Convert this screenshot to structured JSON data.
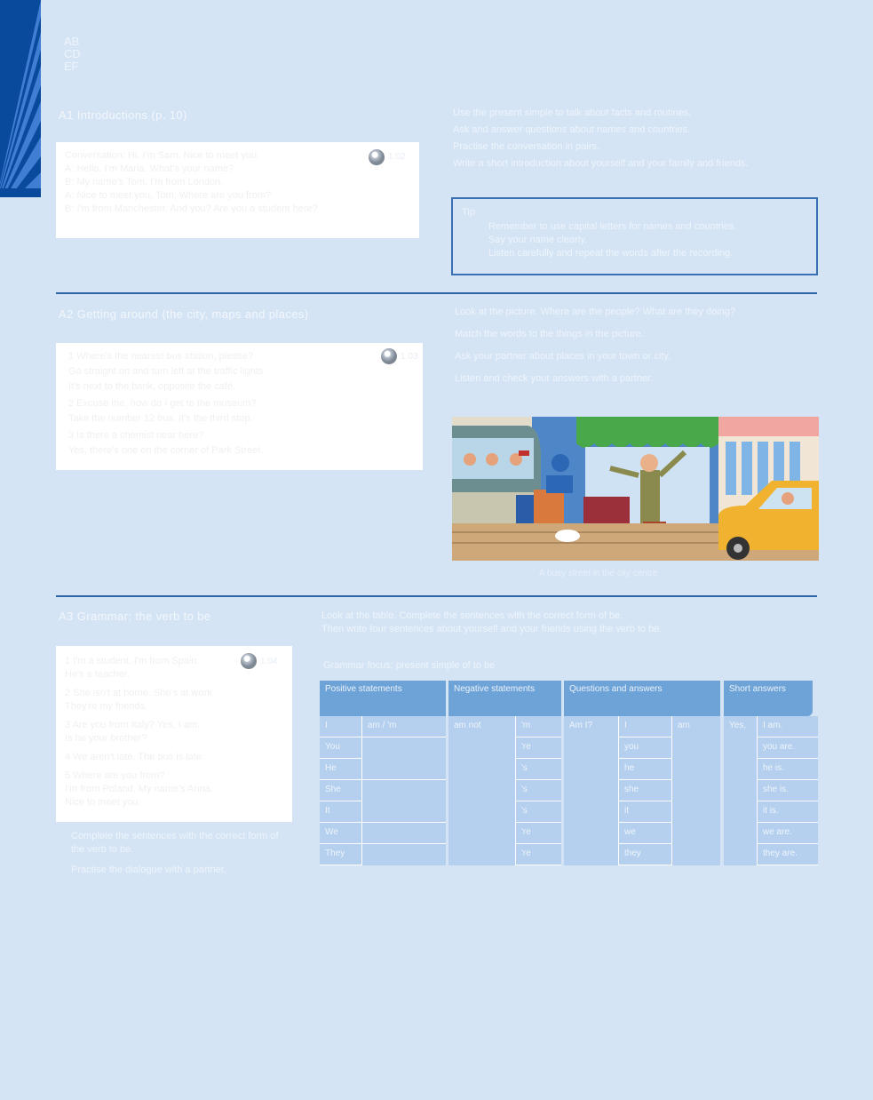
{
  "page": {
    "corner_code": [
      "AB",
      "CD",
      "EF"
    ],
    "colors": {
      "background": "#d4e4f5",
      "rule": "#2f64a8",
      "tab_dark": "#0a4a9c",
      "table_header": "#6ea3d8",
      "table_body": "#b4d0ee"
    }
  },
  "section1": {
    "heading": "A1  Introductions  (p. 10)",
    "box_lines": [
      "Conversation: Hi, I'm Sam. Nice to meet you.",
      "A: Hello. I'm Maria. What's your name?",
      "B: My name's Tom. I'm from London.",
      "A: Nice to meet you, Tom. Where are you from?",
      "B: I'm from Manchester. And you? Are you a student here?"
    ],
    "cd_label": "1.02",
    "right_bullets": [
      "Use the present simple to talk about facts and routines.",
      "Ask and answer questions about names and countries.",
      "Practise the conversation in pairs.",
      "Write a short introduction about yourself and your family and friends."
    ],
    "note_title": "Tip",
    "note_lines": [
      "Remember to use capital letters for names and countries.",
      "Say your name clearly.",
      "Listen carefully and repeat the words after the recording."
    ]
  },
  "section2": {
    "heading": "A2  Getting around  (the city, maps and places)",
    "box_items": [
      "1  Where's the nearest bus station, please?",
      "   Go straight on and turn left at the traffic lights.",
      "   It's next to the bank, opposite the café.",
      "2  Excuse me, how do I get to the museum?",
      "   Take the number 12 bus. It's the third stop.",
      "3  Is there a chemist near here?",
      "   Yes, there's one on the corner of Park Street."
    ],
    "cd_label": "1.03",
    "right_bullets": [
      "Look at the picture. Where are the people? What are they doing?",
      "Match the words to the things in the picture.",
      "Ask your partner about places in your town or city.",
      "Listen and check your answers with a partner."
    ],
    "caption": "A busy street in the city centre"
  },
  "section3": {
    "heading": "A3  Grammar: the verb to be",
    "box_items": [
      "1  I'm a student. I'm from Spain.",
      "   He's a teacher.",
      "2  She isn't at home. She's at work.",
      "   They're my friends.",
      "3  Are you from Italy? Yes, I am.",
      "   Is he your brother?",
      "4  We aren't late. The bus is late.",
      "5  Where are you from?",
      "   I'm from Poland. My name's Anna.",
      "   Nice to meet you."
    ],
    "cd_label": "1.04",
    "below_bullets": [
      "Complete the sentences with the correct form of the verb to be.",
      "Practise the dialogue with a partner."
    ],
    "intro_lines": [
      "Look at the table. Complete the sentences with the correct form of be.",
      "Then write four sentences about yourself and your friends using the verb to be."
    ],
    "table_title": "Grammar focus: present simple of to be",
    "table": {
      "headers": [
        "Positive statements",
        "Negative statements",
        "Questions and answers",
        "Short answers"
      ],
      "col1_subject": [
        "I",
        "You",
        "He",
        "She",
        "It",
        "We",
        "They"
      ],
      "col1_verb": [
        "am / 'm"
      ],
      "col2_verb": [
        "am not"
      ],
      "col2_right": [
        "'m",
        "'re",
        "'s",
        "'s",
        "'s",
        "'re",
        "'re"
      ],
      "col3_left": [
        "Am I?"
      ],
      "col3_mid": [
        "I",
        "you",
        "he",
        "she",
        "it",
        "we",
        "they"
      ],
      "col3_right": [
        "am"
      ],
      "col4_left": [
        "Yes,"
      ],
      "col4_right": [
        "I am.",
        "you are.",
        "he is.",
        "she is.",
        "it is.",
        "we are.",
        "they are."
      ]
    }
  }
}
